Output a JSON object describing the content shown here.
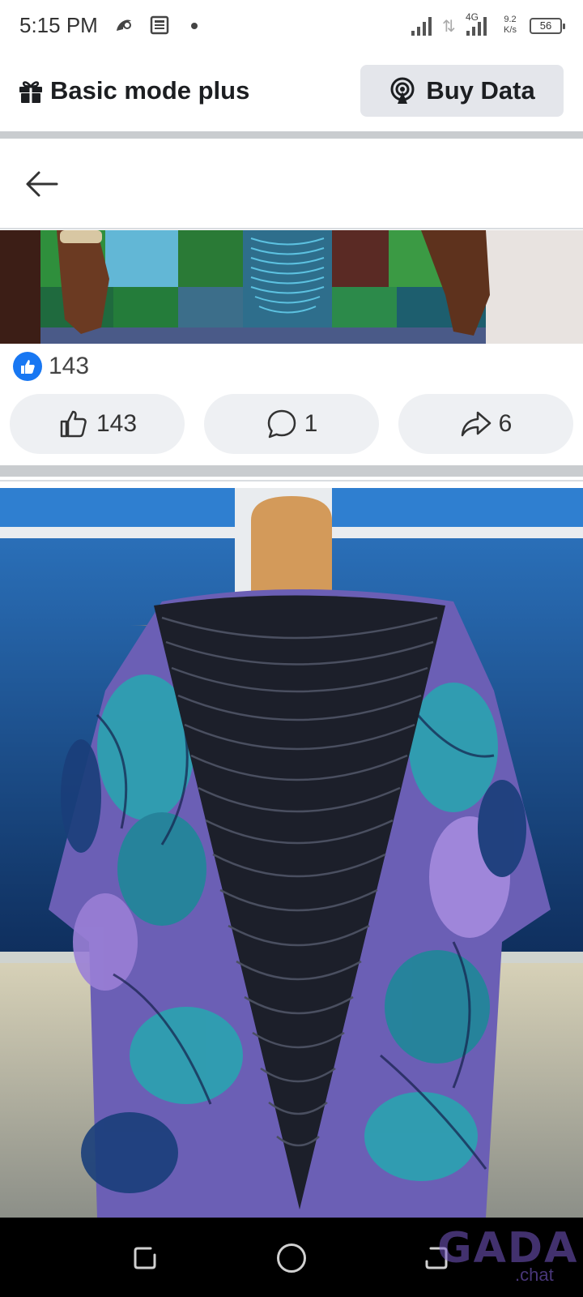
{
  "status_bar": {
    "time": "5:15 PM",
    "network_type": "4G",
    "speed_value": "9.2",
    "speed_unit": "K/s",
    "battery_level": "56"
  },
  "top_bar": {
    "basic_mode_label": "Basic mode plus",
    "buy_data_label": "Buy Data"
  },
  "post": {
    "reaction_count": "143",
    "actions": {
      "like_count": "143",
      "comment_count": "1",
      "share_count": "6"
    }
  },
  "watermark": {
    "brand": "GADA",
    "suffix": ".chat"
  },
  "icons": {
    "back": "arrow-left-icon",
    "gift": "gift-icon",
    "buy_data": "broadcast-icon",
    "like": "thumbs-up-icon",
    "comment": "comment-bubble-icon",
    "share": "share-arrow-icon"
  },
  "colors": {
    "facebook_blue": "#1877f2",
    "button_bg": "#e4e6eb",
    "divider": "#c9cccf"
  }
}
